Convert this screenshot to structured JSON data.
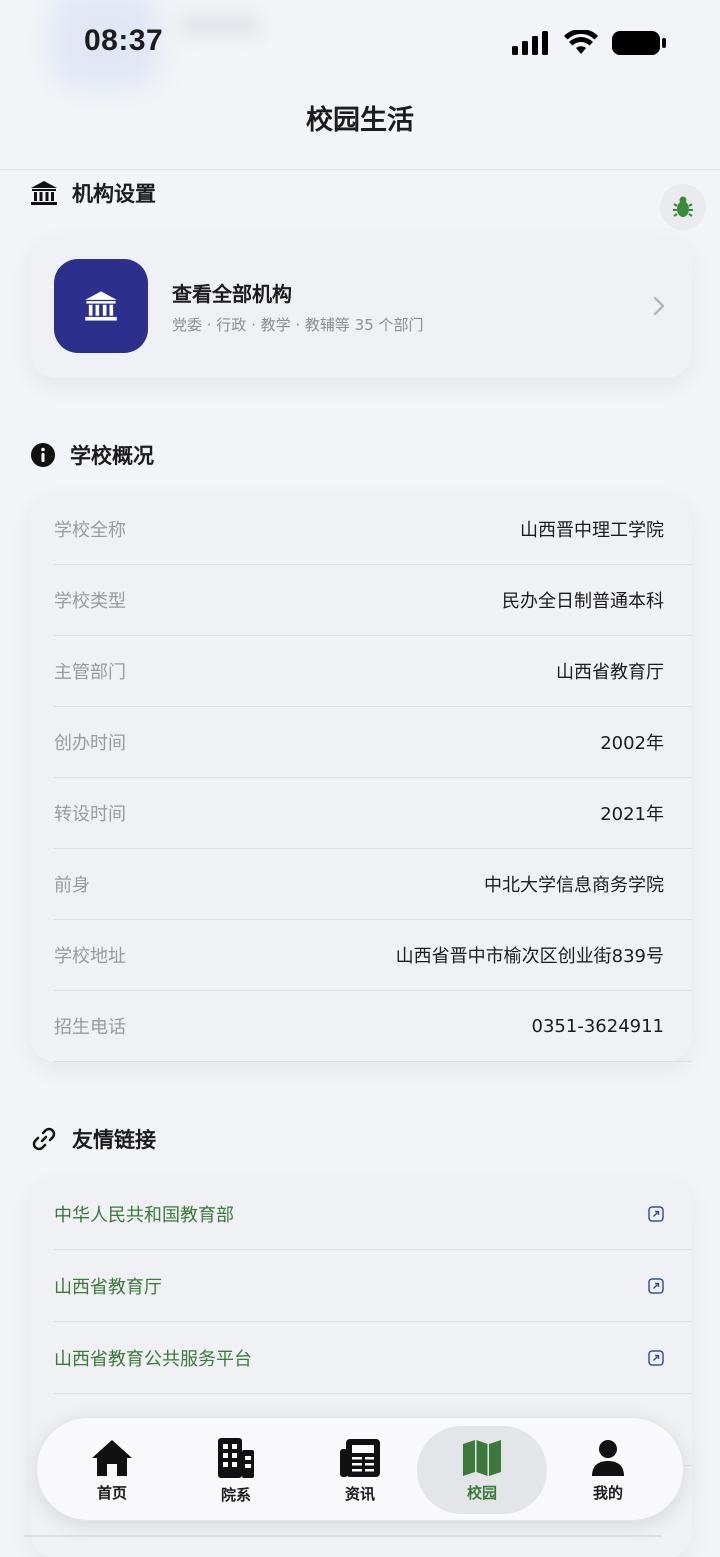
{
  "status_bar": {
    "time": "08:37"
  },
  "nav": {
    "title": "校园生活"
  },
  "institutions": {
    "section_title": "机构设置",
    "card_title": "查看全部机构",
    "card_subtitle": "党委 · 行政 · 教学 · 教辅等 35 个部门"
  },
  "overview": {
    "section_title": "学校概况",
    "rows": [
      {
        "key": "学校全称",
        "value": "山西晋中理工学院"
      },
      {
        "key": "学校类型",
        "value": "民办全日制普通本科"
      },
      {
        "key": "主管部门",
        "value": "山西省教育厅"
      },
      {
        "key": "创办时间",
        "value": "2002年"
      },
      {
        "key": "转设时间",
        "value": "2021年"
      },
      {
        "key": "前身",
        "value": "中北大学信息商务学院"
      },
      {
        "key": "学校地址",
        "value": "山西省晋中市榆次区创业街839号"
      },
      {
        "key": "招生电话",
        "value": "0351-3624911"
      }
    ]
  },
  "links": {
    "section_title": "友情链接",
    "items": [
      {
        "label": "中华人民共和国教育部"
      },
      {
        "label": "山西省教育厅"
      },
      {
        "label": "山西省教育公共服务平台"
      }
    ]
  },
  "tabbar": {
    "tabs": [
      {
        "label": "首页",
        "icon": "home-icon"
      },
      {
        "label": "院系",
        "icon": "building-icon"
      },
      {
        "label": "资讯",
        "icon": "newspaper-icon"
      },
      {
        "label": "校园",
        "icon": "map-icon",
        "active": true
      },
      {
        "label": "我的",
        "icon": "person-icon"
      }
    ]
  },
  "colors": {
    "accent_green": "#3b7a3b",
    "institution_icon_bg": "#2d2f8c",
    "link_icon": "#3a4fa0"
  }
}
